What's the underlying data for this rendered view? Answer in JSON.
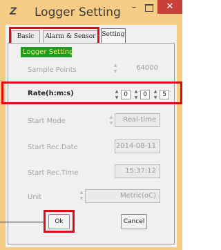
{
  "window": {
    "title": "Logger Setting",
    "app_icon": "Z",
    "minimize": "–",
    "close": "✕"
  },
  "tabs": [
    {
      "label": "Basic"
    },
    {
      "label": "Alarm & Sensor"
    },
    {
      "label": "Setting"
    }
  ],
  "panel_header": "Logger Setting",
  "fields": {
    "sample_points": {
      "label": "Sample Points",
      "value": "64000"
    },
    "rate": {
      "label": "Rate(h:m:s)",
      "hours": "0",
      "minutes": "0",
      "seconds": "5"
    },
    "start_mode": {
      "label": "Start Mode",
      "value": "Real-time"
    },
    "start_date": {
      "label": "Start Rec.Date",
      "value": "2014-08-11"
    },
    "start_time": {
      "label": "Start Rec.Time",
      "value": "15:37:12"
    },
    "unit": {
      "label": "Unit",
      "value": "Metric(oC)"
    }
  },
  "buttons": {
    "ok": "Ok",
    "cancel": "Cancel"
  },
  "colors": {
    "frame": "#f7cd86",
    "close_button": "#c7403a",
    "annotation": "#e00a15",
    "header_bg": "#1f9a26",
    "header_text": "#e9f26a"
  }
}
